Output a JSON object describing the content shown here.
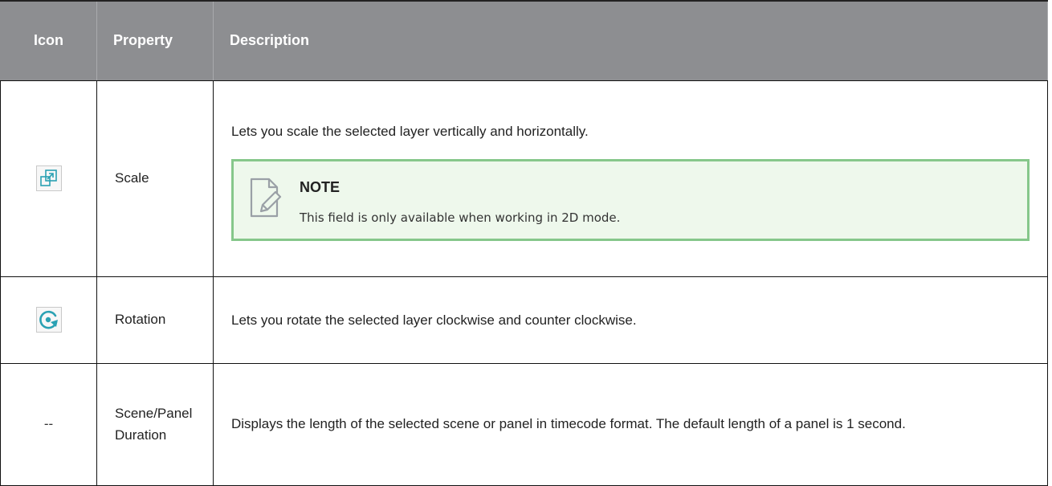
{
  "table": {
    "headers": {
      "icon": "Icon",
      "property": "Property",
      "description": "Description"
    },
    "rows": [
      {
        "icon": "scale-icon",
        "property": "Scale",
        "description": "Lets you scale the selected layer vertically and horizontally.",
        "note": {
          "title": "NOTE",
          "text": "This field is only available when working in 2D mode."
        }
      },
      {
        "icon": "rotation-icon",
        "property": "Rotation",
        "description": "Lets you rotate the selected layer clockwise and counter clockwise."
      },
      {
        "icon_text": "--",
        "property_line1": "Scene/Panel",
        "property_line2": "Duration",
        "description": "Displays the length of the selected scene or panel in timecode format. The default length of a panel is 1 second."
      }
    ]
  },
  "colors": {
    "header_bg": "#8d8e91",
    "note_border": "#86c78b",
    "note_bg": "#eef8ec",
    "icon_accent": "#2aa1b3"
  }
}
